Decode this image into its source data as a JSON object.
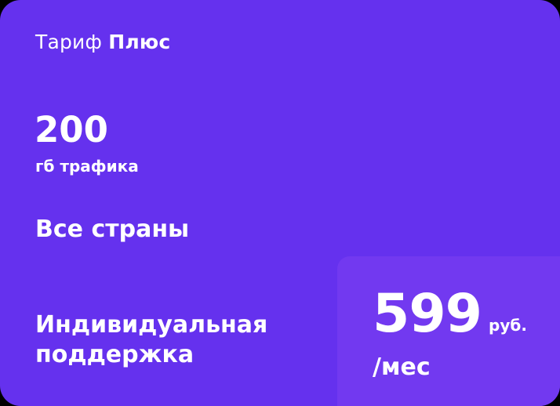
{
  "tariff": {
    "title_prefix": "Тариф",
    "title_name": "Плюс"
  },
  "features": {
    "traffic_value": "200",
    "traffic_label": "гб трафика",
    "countries": "Все страны",
    "support": "Индивидуальная поддержка"
  },
  "price": {
    "amount": "599",
    "currency": "руб.",
    "period": "/мес"
  },
  "colors": {
    "card_background": "#6531ee",
    "price_box_background": "#7239f0",
    "text": "#ffffff"
  }
}
